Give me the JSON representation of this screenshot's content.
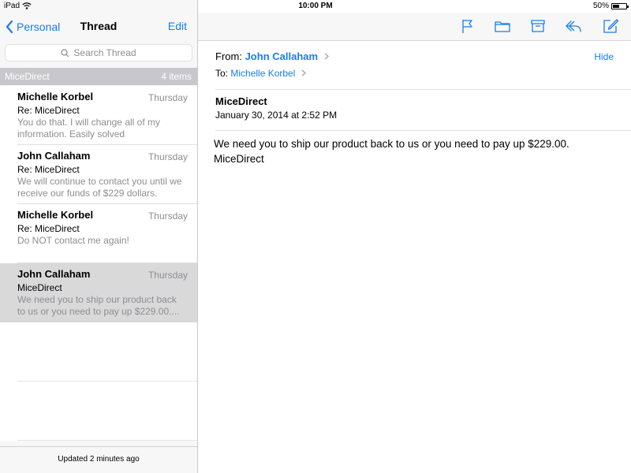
{
  "status_bar": {
    "device": "iPad",
    "time": "10:00 PM",
    "battery_percent": "50%",
    "battery_level": 0.5,
    "wifi_icon": "wifi-icon",
    "battery_icon": "battery-icon"
  },
  "left_nav": {
    "back_label": "Personal",
    "title": "Thread",
    "edit_label": "Edit"
  },
  "search": {
    "placeholder": "Search Thread",
    "icon": "search-icon"
  },
  "section": {
    "title": "MiceDirect",
    "count": "4 items"
  },
  "messages": [
    {
      "sender": "Michelle Korbel",
      "date": "Thursday",
      "subject": "Re: MiceDirect",
      "preview_lines": [
        "You do that. I will change all of my",
        "information. Easily solved"
      ],
      "selected": false
    },
    {
      "sender": "John Callaham",
      "date": "Thursday",
      "subject": "Re: MiceDirect",
      "preview_lines": [
        "We will continue to contact you until we",
        "receive our funds of $229 dollars."
      ],
      "selected": false
    },
    {
      "sender": "Michelle Korbel",
      "date": "Thursday",
      "subject": "Re: MiceDirect",
      "preview_lines": [
        "Do NOT contact me again!"
      ],
      "selected": false
    },
    {
      "sender": "John Callaham",
      "date": "Thursday",
      "subject": "MiceDirect",
      "preview_lines": [
        "We need you to ship our product back",
        "to us or you need to pay up $229.00...."
      ],
      "selected": true
    }
  ],
  "footer": {
    "updated": "Updated 2 minutes ago"
  },
  "toolbar": {
    "icons": [
      "flag-icon",
      "folder-icon",
      "archive-icon",
      "reply-icon",
      "compose-icon"
    ],
    "accent": "#1a7cf0"
  },
  "email": {
    "from_label": "From:",
    "from_name": "John Callaham",
    "to_label": "To:",
    "to_name": "Michelle Korbel",
    "hide_label": "Hide",
    "subject": "MiceDirect",
    "date": "January 30, 2014 at 2:52 PM",
    "body_lines": [
      "We need you to ship our product back to us or you need to pay up $229.00.",
      "MiceDirect"
    ]
  }
}
